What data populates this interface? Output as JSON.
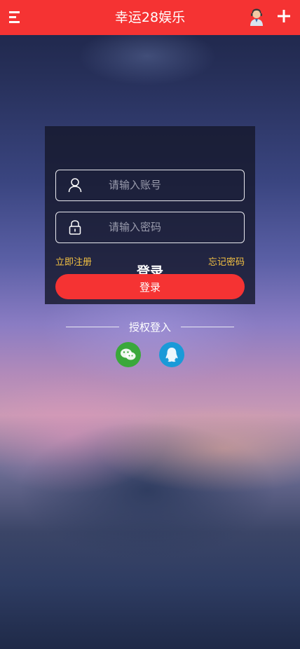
{
  "header": {
    "title": "幸运28娱乐",
    "menu_icon": "menu-icon",
    "service_icon": "customer-service-icon",
    "add_icon": "plus-icon",
    "bg_color": "#f53333"
  },
  "login": {
    "title": "登录",
    "account": {
      "placeholder": "请输入账号",
      "value": "",
      "icon": "user-icon"
    },
    "password": {
      "placeholder": "请输入密码",
      "value": "",
      "icon": "lock-icon"
    },
    "register_label": "立即注册",
    "forgot_label": "忘记密码",
    "submit_label": "登录"
  },
  "oauth": {
    "label": "授权登入",
    "providers": [
      {
        "name": "wechat",
        "icon": "wechat-icon",
        "color": "#3aa83a"
      },
      {
        "name": "qq",
        "icon": "qq-icon",
        "color": "#1a9ad8"
      }
    ]
  },
  "colors": {
    "accent": "#f53333",
    "link": "#f5c342"
  }
}
